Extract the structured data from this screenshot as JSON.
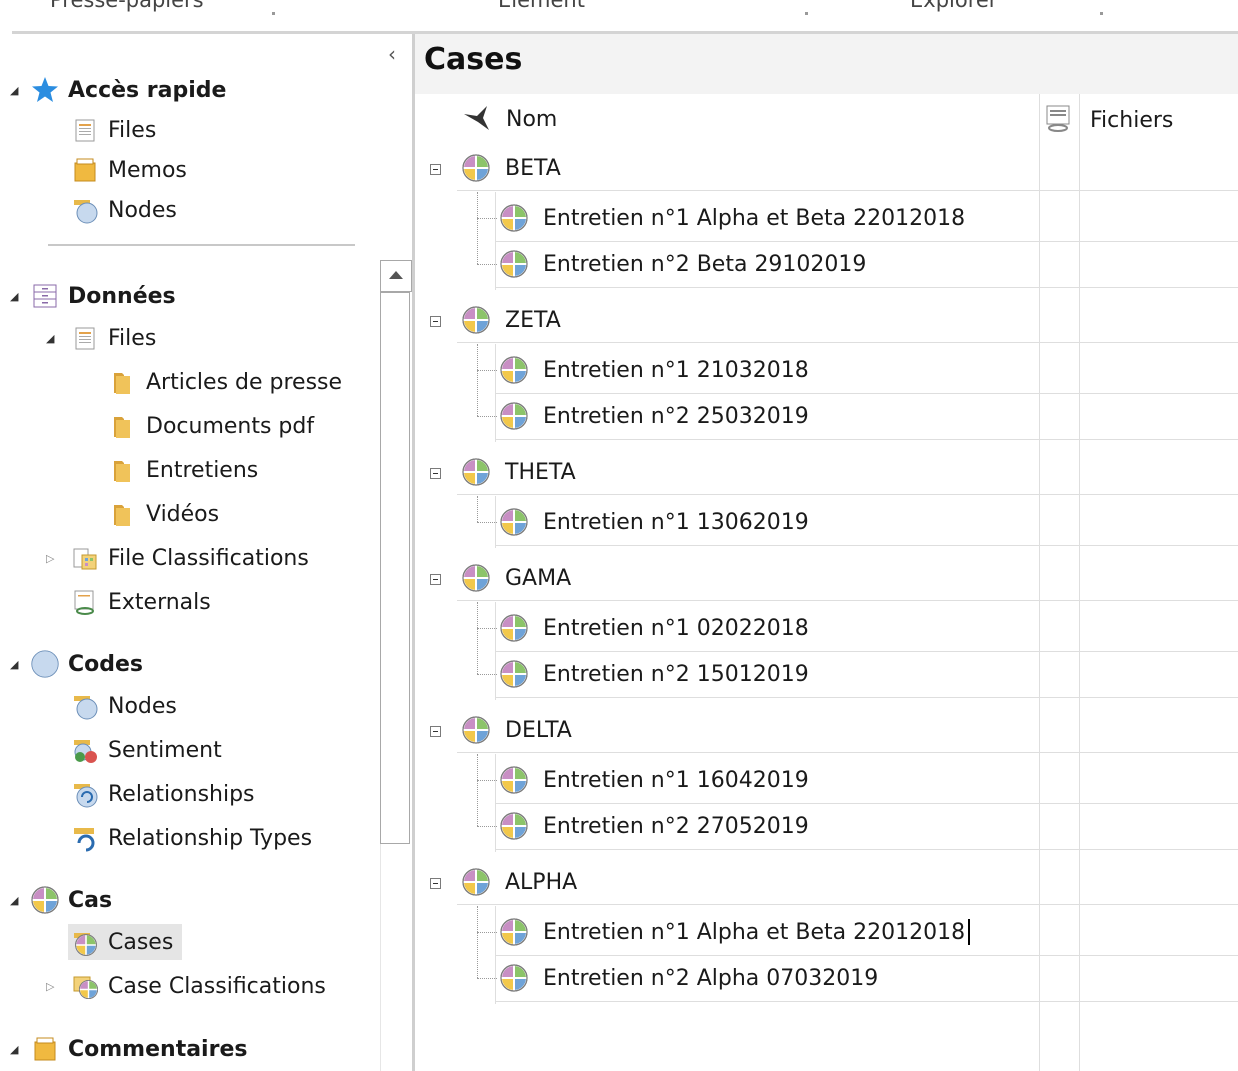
{
  "ribbon": {
    "groups": [
      "Presse-papiers",
      "Élément",
      "Explorer"
    ]
  },
  "nav": {
    "collapse_glyph": "‹",
    "sections": [
      {
        "label": "Accès rapide",
        "icon": "star-icon",
        "items": [
          {
            "label": "Files",
            "icon": "files-icon"
          },
          {
            "label": "Memos",
            "icon": "memos-icon"
          },
          {
            "label": "Nodes",
            "icon": "nodes-icon"
          }
        ]
      },
      {
        "label": "Données",
        "icon": "data-icon",
        "items": [
          {
            "label": "Files",
            "icon": "files-icon"
          },
          {
            "label": "Articles de presse",
            "icon": "folder-icon"
          },
          {
            "label": "Documents pdf",
            "icon": "folder-icon"
          },
          {
            "label": "Entretiens",
            "icon": "folder-icon"
          },
          {
            "label": "Vidéos",
            "icon": "folder-icon"
          },
          {
            "label": "File Classifications",
            "icon": "file-classifications-icon"
          },
          {
            "label": "Externals",
            "icon": "externals-icon"
          }
        ]
      },
      {
        "label": "Codes",
        "icon": "codes-icon",
        "items": [
          {
            "label": "Nodes",
            "icon": "nodes-icon"
          },
          {
            "label": "Sentiment",
            "icon": "sentiment-icon"
          },
          {
            "label": "Relationships",
            "icon": "relationships-icon"
          },
          {
            "label": "Relationship Types",
            "icon": "relationship-types-icon"
          }
        ]
      },
      {
        "label": "Cas",
        "icon": "case-icon",
        "items": [
          {
            "label": "Cases",
            "icon": "cases-icon",
            "selected": true
          },
          {
            "label": "Case Classifications",
            "icon": "case-classifications-icon"
          }
        ]
      },
      {
        "label": "Commentaires",
        "icon": "comments-icon",
        "items": []
      }
    ]
  },
  "main": {
    "title": "Cases",
    "columns": {
      "name": "Nom",
      "files": "Fichiers"
    },
    "cases": [
      {
        "name": "BETA",
        "children": [
          "Entretien n°1 Alpha et Beta 22012018",
          "Entretien n°2 Beta 29102019"
        ]
      },
      {
        "name": "ZETA",
        "children": [
          "Entretien n°1 21032018",
          "Entretien n°2  25032019"
        ]
      },
      {
        "name": "THETA",
        "children": [
          "Entretien n°1 13062019"
        ]
      },
      {
        "name": "GAMA",
        "children": [
          "Entretien n°1 02022018",
          "Entretien n°2 15012019"
        ]
      },
      {
        "name": "DELTA",
        "children": [
          "Entretien n°1 16042019",
          "Entretien n°2 27052019"
        ]
      },
      {
        "name": "ALPHA",
        "children": [
          "Entretien n°1  Alpha et Beta 22012018",
          "Entretien n°2 Alpha 07032019"
        ]
      }
    ]
  },
  "colors": {
    "pie_yellow": "#f2c84b",
    "pie_blue": "#6fa3d8",
    "pie_pink": "#c88fc4",
    "pie_green": "#8cc46a",
    "star": "#2b8de0",
    "folder": "#e8b94a"
  }
}
